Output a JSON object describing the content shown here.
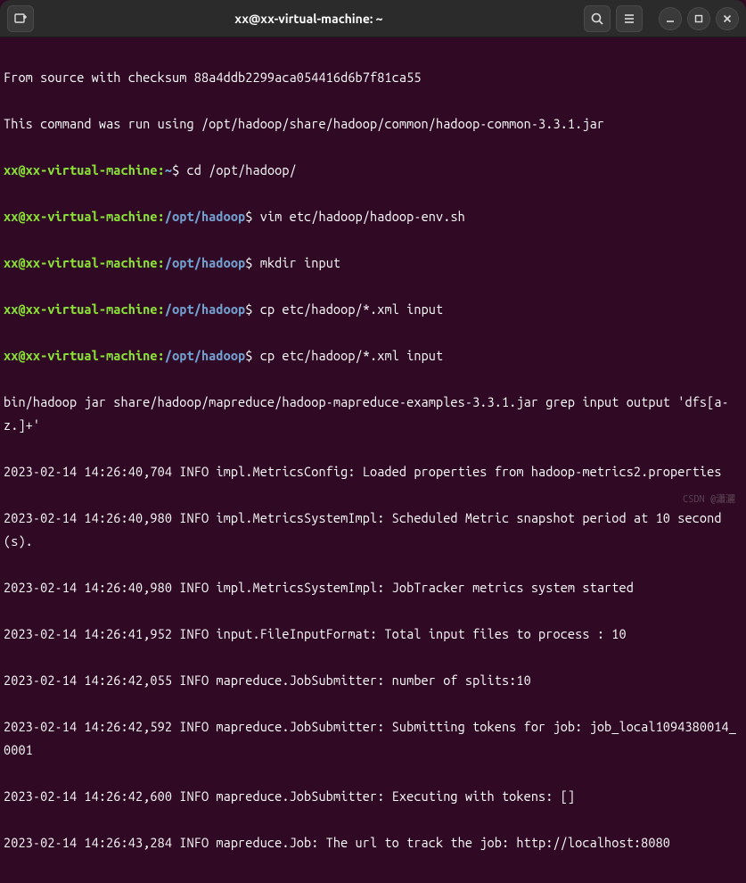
{
  "window": {
    "title": "xx@xx-virtual-machine: ~"
  },
  "prompt": {
    "user_host": "xx@xx-virtual-machine",
    "home_path": "~",
    "hadoop_path": "/opt/hadoop"
  },
  "commands": {
    "cd": "cd /opt/hadoop/",
    "vim": "vim etc/hadoop/hadoop-env.sh",
    "mkdir": "mkdir input",
    "cp1": "cp etc/hadoop/*.xml input",
    "cp2": "cp etc/hadoop/*.xml input"
  },
  "lines": {
    "l1": "From source with checksum 88a4ddb2299aca054416d6b7f81ca55",
    "l2": "This command was run using /opt/hadoop/share/hadoop/common/hadoop-common-3.3.1.jar",
    "l3": "bin/hadoop jar share/hadoop/mapreduce/hadoop-mapreduce-examples-3.3.1.jar grep input output 'dfs[a-z.]+'",
    "l4": "2023-02-14 14:26:40,704 INFO impl.MetricsConfig: Loaded properties from hadoop-metrics2.properties",
    "l5": "2023-02-14 14:26:40,980 INFO impl.MetricsSystemImpl: Scheduled Metric snapshot period at 10 second(s).",
    "l6": "2023-02-14 14:26:40,980 INFO impl.MetricsSystemImpl: JobTracker metrics system started",
    "l7": "2023-02-14 14:26:41,952 INFO input.FileInputFormat: Total input files to process : 10",
    "l8": "2023-02-14 14:26:42,055 INFO mapreduce.JobSubmitter: number of splits:10",
    "l9": "2023-02-14 14:26:42,592 INFO mapreduce.JobSubmitter: Submitting tokens for job: job_local1094380014_0001",
    "l10": "2023-02-14 14:26:42,600 INFO mapreduce.JobSubmitter: Executing with tokens: []",
    "l11": "2023-02-14 14:26:43,284 INFO mapreduce.Job: The url to track the job: http://localhost:8080"
  },
  "watermark": "CSDN @瀟灑"
}
